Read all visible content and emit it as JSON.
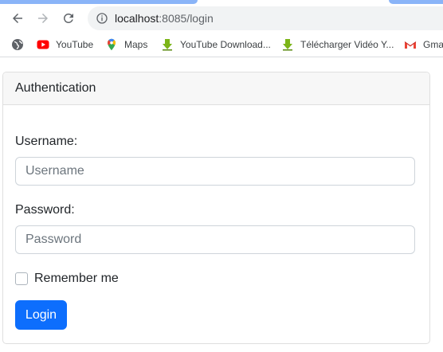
{
  "browser": {
    "url_host": "localhost",
    "url_path": ":8085/login"
  },
  "bookmarks": [
    {
      "label": "",
      "icon": "globe-icon"
    },
    {
      "label": "YouTube",
      "icon": "youtube-icon"
    },
    {
      "label": "Maps",
      "icon": "maps-pin-icon"
    },
    {
      "label": "YouTube Download...",
      "icon": "download-arrow-icon"
    },
    {
      "label": "Télécharger Vidéo Y...",
      "icon": "download-arrow-icon"
    },
    {
      "label": "Gma",
      "icon": "gmail-icon"
    }
  ],
  "page": {
    "card_title": "Authentication",
    "username_label": "Username:",
    "username_placeholder": "Username",
    "password_label": "Password:",
    "password_placeholder": "Password",
    "remember_label": "Remember me",
    "login_label": "Login"
  },
  "colors": {
    "primary": "#0d6efd",
    "header_bg": "#f7f7f7",
    "omnibox_bg": "#f1f3f4",
    "youtube_red": "#ff0000",
    "download_green": "#7cb518"
  }
}
